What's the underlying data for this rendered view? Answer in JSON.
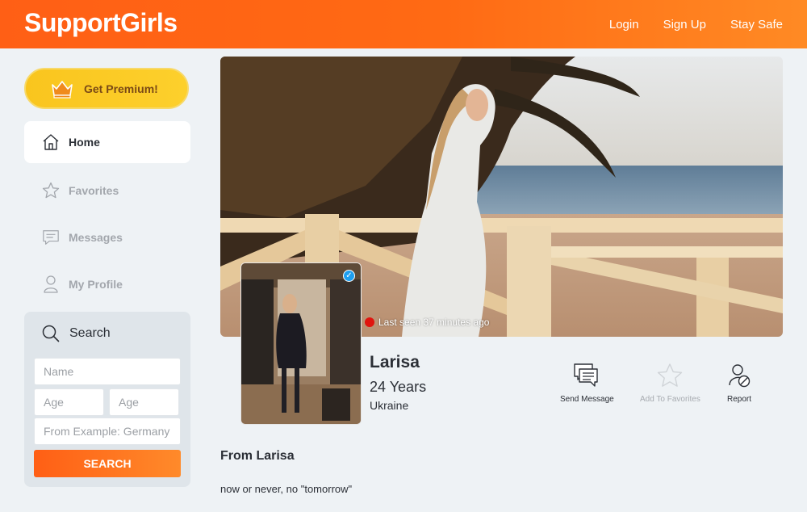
{
  "header": {
    "logo": "SupportGirls",
    "nav": [
      "Login",
      "Sign Up",
      "Stay Safe"
    ]
  },
  "sidebar": {
    "premium_label": "Get Premium!",
    "items": [
      {
        "label": "Home",
        "icon": "home-icon",
        "active": true
      },
      {
        "label": "Favorites",
        "icon": "star-icon",
        "active": false
      },
      {
        "label": "Messages",
        "icon": "message-icon",
        "active": false
      },
      {
        "label": "My Profile",
        "icon": "user-icon",
        "active": false
      }
    ]
  },
  "search": {
    "title": "Search",
    "name_placeholder": "Name",
    "age_from_placeholder": "Age",
    "age_to_placeholder": "Age",
    "country_placeholder": "From Example: Germany",
    "button_label": "SEARCH"
  },
  "profile": {
    "last_seen": "Last seen 37 minutes ago",
    "name": "Larisa",
    "age": "24 Years",
    "country": "Ukraine",
    "verified": true,
    "actions": [
      {
        "label": "Send Message",
        "icon": "send-message-icon",
        "enabled": true
      },
      {
        "label": "Add To Favorites",
        "icon": "star-icon",
        "enabled": false
      },
      {
        "label": "Report",
        "icon": "report-icon",
        "enabled": true
      }
    ],
    "about_title": "From Larisa",
    "about_text": "now or never, no \"tomorrow\""
  },
  "colors": {
    "brand_orange": "#ff6a14",
    "premium_yellow": "#fdd02c",
    "online_dot": "#e0140e",
    "verified_blue": "#1e9ff0"
  }
}
